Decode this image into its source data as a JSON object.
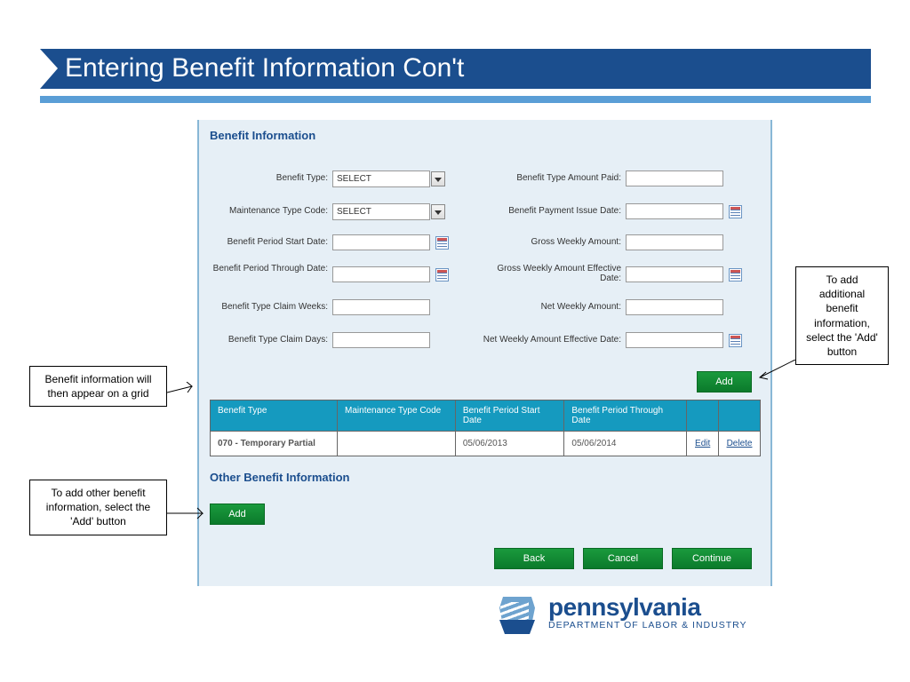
{
  "slide": {
    "title": "Entering Benefit Information Con't"
  },
  "panel": {
    "section1_title": "Benefit Information",
    "section2_title": "Other Benefit Information",
    "labels": {
      "benefit_type": "Benefit Type:",
      "mtc": "Maintenance Type Code:",
      "start_date": "Benefit Period Start Date:",
      "through_date": "Benefit Period Through Date:",
      "claim_weeks": "Benefit Type Claim Weeks:",
      "claim_days": "Benefit Type Claim Days:",
      "amount_paid": "Benefit Type Amount Paid:",
      "issue_date": "Benefit Payment Issue Date:",
      "gross_weekly": "Gross Weekly Amount:",
      "gross_weekly_eff": "Gross Weekly Amount Effective Date:",
      "net_weekly": "Net Weekly Amount:",
      "net_weekly_eff": "Net Weekly Amount Effective Date:"
    },
    "select_placeholder": "SELECT",
    "buttons": {
      "add": "Add",
      "back": "Back",
      "cancel": "Cancel",
      "continue": "Continue"
    },
    "grid": {
      "headers": {
        "c1": "Benefit Type",
        "c2": "Maintenance Type Code",
        "c3": "Benefit Period Start Date",
        "c4": "Benefit Period Through Date"
      },
      "row": {
        "benefit_type": "070 - Temporary Partial",
        "mtc": "",
        "start": "05/06/2013",
        "through": "05/06/2014",
        "edit": "Edit",
        "delete": "Delete"
      }
    }
  },
  "callouts": {
    "left_grid": "Benefit information will then appear on a grid",
    "left_add": "To add other benefit information, select the 'Add' button",
    "right_add": "To add additional benefit information, select the 'Add' button"
  },
  "footer": {
    "state": "pennsylvania",
    "dept": "DEPARTMENT OF LABOR & INDUSTRY"
  }
}
